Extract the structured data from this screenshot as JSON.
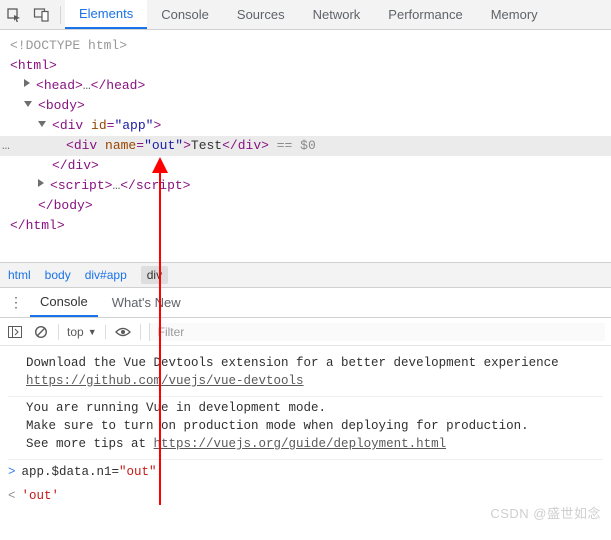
{
  "toolbar": {
    "tabs": [
      "Elements",
      "Console",
      "Sources",
      "Network",
      "Performance",
      "Memory"
    ],
    "active_tab": "Elements"
  },
  "elements": {
    "lines": {
      "doctype": "<!DOCTYPE html>",
      "html_open": "html",
      "head_open": "head",
      "head_ellipsis": "…",
      "head_close": "head",
      "body_open": "body",
      "app_open_tag": "div",
      "app_attr_name": "id",
      "app_attr_val": "\"app\"",
      "sel_open_tag": "div",
      "sel_attr_name": "name",
      "sel_attr_val": "\"out\"",
      "sel_text": "Test",
      "sel_close": "div",
      "sel_after": " == $0",
      "app_close": "div",
      "script_open": "script",
      "script_ellipsis": "…",
      "script_close": "script",
      "body_close": "body",
      "html_close": "html"
    }
  },
  "breadcrumb": [
    "html",
    "body",
    "div#app",
    "div"
  ],
  "drawer": {
    "tabs": [
      "Console",
      "What's New"
    ],
    "active": "Console"
  },
  "console_toolbar": {
    "context": "top",
    "filter_placeholder": "Filter"
  },
  "console": {
    "msg1_l1": "Download the Vue Devtools extension for a better development experience",
    "msg1_link": "https://github.com/vuejs/vue-devtools",
    "msg2_l1": "You are running Vue in development mode.",
    "msg2_l2": "Make sure to turn on production mode when deploying for production.",
    "msg2_l3a": "See more tips at ",
    "msg2_link": "https://vuejs.org/guide/deployment.html",
    "cmd_pre": "app.$data.n1=",
    "cmd_str": "\"out\"",
    "res": "'out'"
  },
  "watermark": "CSDN @盛世如念"
}
